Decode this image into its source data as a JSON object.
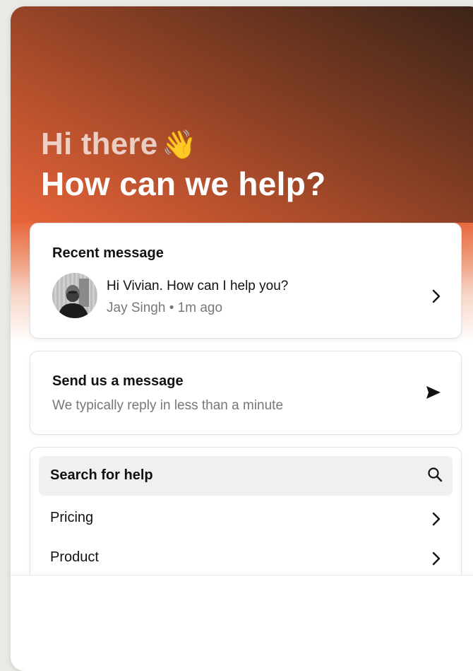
{
  "header": {
    "greeting": "Hi there",
    "greeting_emoji": "👋",
    "headline": "How can we help?"
  },
  "recent_message": {
    "title": "Recent message",
    "text": "Hi Vivian.  How can I help you?",
    "sender": "Jay Singh",
    "separator": "•",
    "time": "1m ago"
  },
  "send_message": {
    "title": "Send us a message",
    "subtitle": "We typically reply in less than a minute"
  },
  "help": {
    "search_label": "Search for help",
    "items": [
      {
        "label": "Pricing"
      },
      {
        "label": "Product"
      }
    ]
  },
  "icons": {
    "avatar": "avatar-photo",
    "chevron": "chevron-right-icon",
    "send": "send-icon",
    "search": "search-icon"
  },
  "colors": {
    "hero_start": "#e7643a",
    "hero_end": "#3a2318",
    "muted_text": "#777777"
  }
}
